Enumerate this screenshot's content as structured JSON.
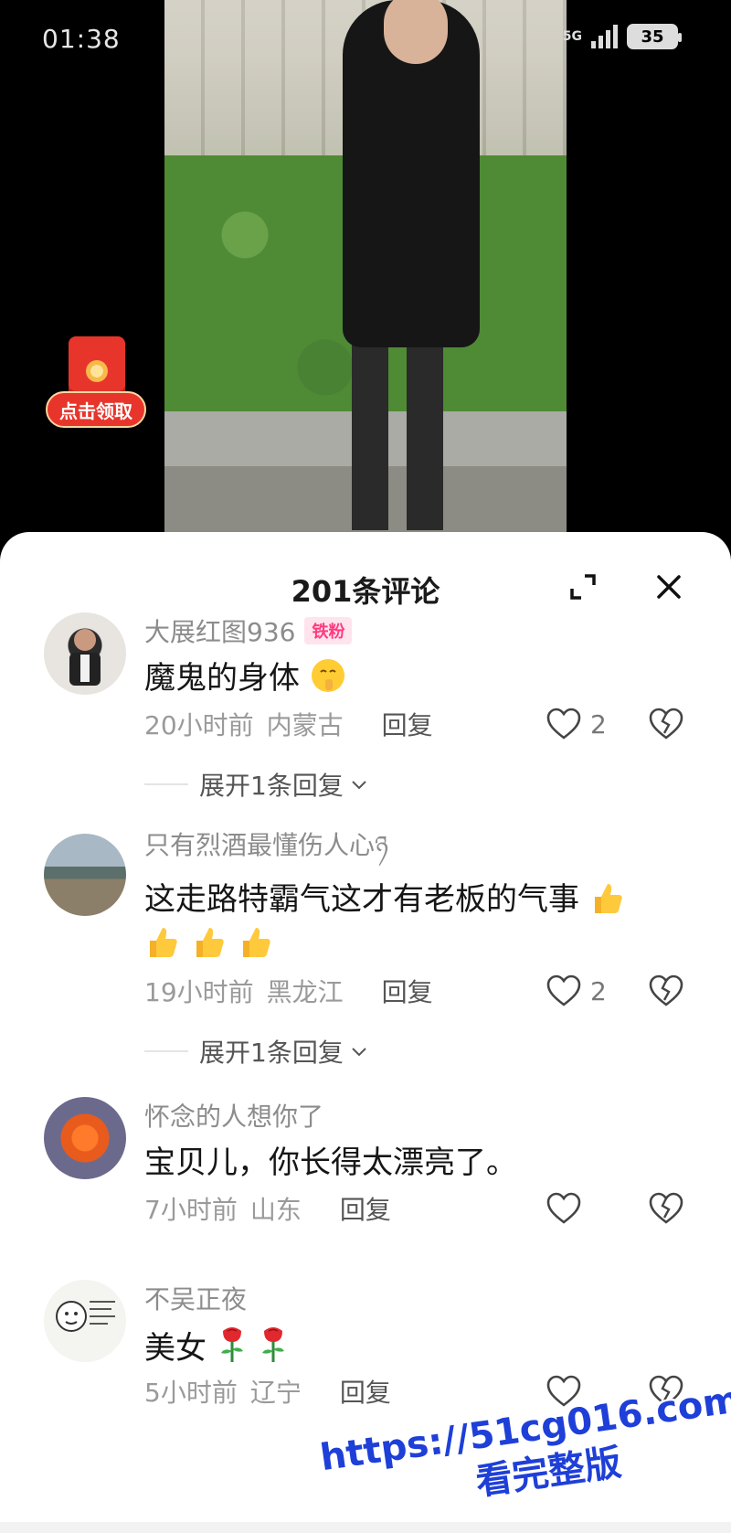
{
  "status_bar": {
    "time": "01:38",
    "network": "5G",
    "battery": "35"
  },
  "redpacket": {
    "label": "点击领取"
  },
  "sheet": {
    "title": "201条评论"
  },
  "comments": [
    {
      "user": "大展红图936",
      "badge": "铁粉",
      "text": "魔鬼的身体",
      "time": "20小时前",
      "location": "内蒙古",
      "reply_label": "回复",
      "likes": "2",
      "expand_label": "展开1条回复"
    },
    {
      "user": "只有烈酒最懂伤人心ཉ",
      "text": "这走路特霸气这才有老板的气事",
      "time": "19小时前",
      "location": "黑龙江",
      "reply_label": "回复",
      "likes": "2",
      "expand_label": "展开1条回复"
    },
    {
      "user": "怀念的人想你了",
      "text": "宝贝儿，你长得太漂亮了。",
      "time": "7小时前",
      "location": "山东",
      "reply_label": "回复",
      "likes": ""
    },
    {
      "user": "不吴正夜",
      "text": "美女",
      "time": "5小时前",
      "location": "辽宁",
      "reply_label": "回复",
      "likes": ""
    }
  ],
  "watermark": {
    "line1": "https://51cg016.com",
    "line2": "看完整版"
  },
  "icons": {
    "expand": "expand-icon",
    "close": "close-icon",
    "like": "heart-outline-icon",
    "dislike": "broken-heart-icon",
    "chevron": "chevron-down-icon"
  }
}
